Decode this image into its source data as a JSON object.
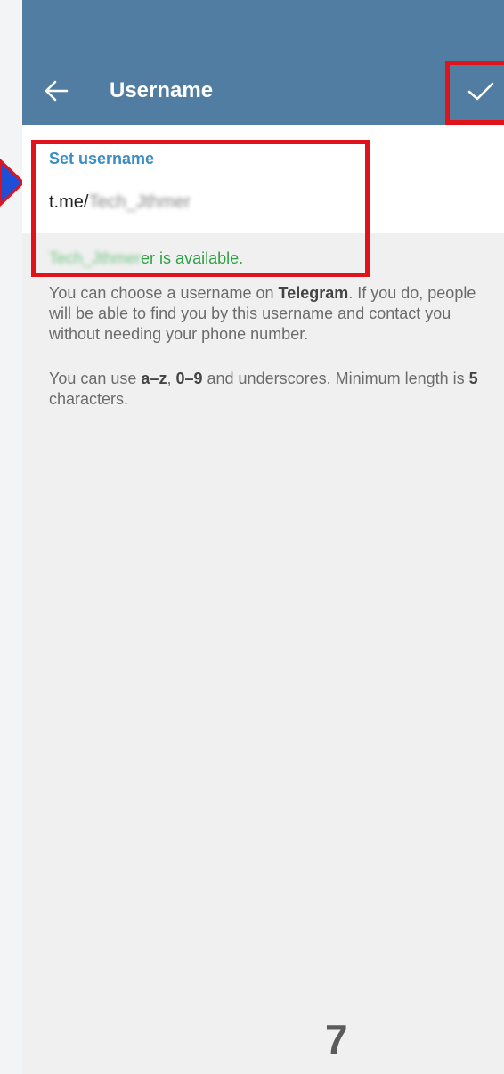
{
  "app_bar": {
    "title": "Username",
    "back_icon": "back-arrow-icon",
    "confirm_icon": "check-icon",
    "color": "#517da2"
  },
  "username_field": {
    "label": "Set username",
    "prefix": "t.me/",
    "value": "Tech_Jthmer"
  },
  "availability": {
    "name": "Tech_Jthmer",
    "suffix": "er is available.",
    "color": "#2ea043"
  },
  "help": {
    "p1_a": "You can choose a username on ",
    "p1_bold": "Telegram",
    "p1_b": ". If you do, people will be able to find you by this username and contact you without needing your phone number.",
    "p2_a": "You can use ",
    "p2_az": "a–z",
    "p2_comma": ", ",
    "p2_09": "0–9",
    "p2_b": " and underscores. Minimum length is ",
    "p2_5": "5",
    "p2_c": " characters."
  },
  "annotations": {
    "highlight_color": "#e0131b",
    "arrow_color": "#1e4fd6"
  },
  "page_number": "7"
}
